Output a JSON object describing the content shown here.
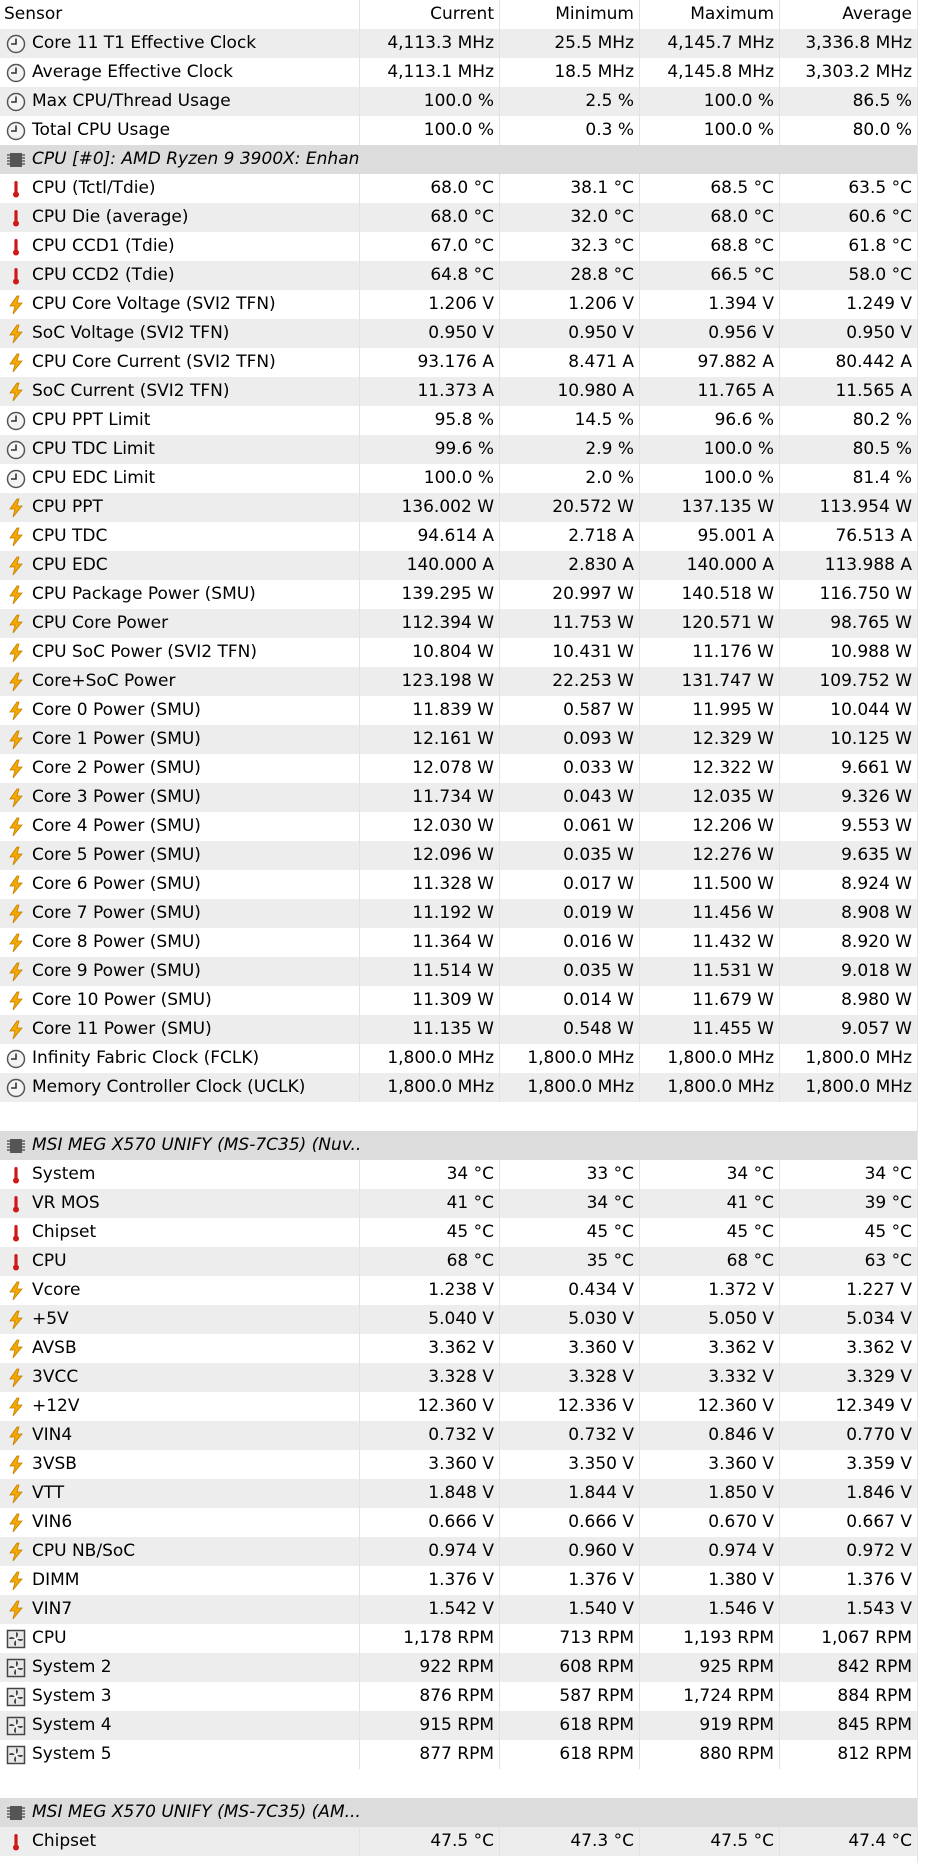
{
  "columns": [
    "Sensor",
    "Current",
    "Minimum",
    "Maximum",
    "Average"
  ],
  "rows": [
    {
      "kind": "sensor",
      "icon": "clock-icon",
      "name": "Core 11 T1 Effective Clock",
      "cur": "4,113.3 MHz",
      "min": "25.5 MHz",
      "max": "4,145.7 MHz",
      "avg": "3,336.8 MHz"
    },
    {
      "kind": "sensor",
      "icon": "clock-icon",
      "name": "Average Effective Clock",
      "cur": "4,113.1 MHz",
      "min": "18.5 MHz",
      "max": "4,145.8 MHz",
      "avg": "3,303.2 MHz"
    },
    {
      "kind": "sensor",
      "icon": "clock-icon",
      "name": "Max CPU/Thread Usage",
      "cur": "100.0 %",
      "min": "2.5 %",
      "max": "100.0 %",
      "avg": "86.5 %"
    },
    {
      "kind": "sensor",
      "icon": "clock-icon",
      "name": "Total CPU Usage",
      "cur": "100.0 %",
      "min": "0.3 %",
      "max": "100.0 %",
      "avg": "80.0 %"
    },
    {
      "kind": "group",
      "icon": "chip-icon",
      "name": "CPU [#0]: AMD Ryzen 9 3900X: Enhan..."
    },
    {
      "kind": "sensor",
      "icon": "thermometer-icon",
      "name": "CPU (Tctl/Tdie)",
      "cur": "68.0 °C",
      "min": "38.1 °C",
      "max": "68.5 °C",
      "avg": "63.5 °C"
    },
    {
      "kind": "sensor",
      "icon": "thermometer-icon",
      "name": "CPU Die (average)",
      "cur": "68.0 °C",
      "min": "32.0 °C",
      "max": "68.0 °C",
      "avg": "60.6 °C"
    },
    {
      "kind": "sensor",
      "icon": "thermometer-icon",
      "name": "CPU CCD1 (Tdie)",
      "cur": "67.0 °C",
      "min": "32.3 °C",
      "max": "68.8 °C",
      "avg": "61.8 °C"
    },
    {
      "kind": "sensor",
      "icon": "thermometer-icon",
      "name": "CPU CCD2 (Tdie)",
      "cur": "64.8 °C",
      "min": "28.8 °C",
      "max": "66.5 °C",
      "avg": "58.0 °C"
    },
    {
      "kind": "sensor",
      "icon": "lightning-icon",
      "name": "CPU Core Voltage (SVI2 TFN)",
      "cur": "1.206 V",
      "min": "1.206 V",
      "max": "1.394 V",
      "avg": "1.249 V"
    },
    {
      "kind": "sensor",
      "icon": "lightning-icon",
      "name": "SoC Voltage (SVI2 TFN)",
      "cur": "0.950 V",
      "min": "0.950 V",
      "max": "0.956 V",
      "avg": "0.950 V"
    },
    {
      "kind": "sensor",
      "icon": "lightning-icon",
      "name": "CPU Core Current (SVI2 TFN)",
      "cur": "93.176 A",
      "min": "8.471 A",
      "max": "97.882 A",
      "avg": "80.442 A"
    },
    {
      "kind": "sensor",
      "icon": "lightning-icon",
      "name": "SoC Current (SVI2 TFN)",
      "cur": "11.373 A",
      "min": "10.980 A",
      "max": "11.765 A",
      "avg": "11.565 A"
    },
    {
      "kind": "sensor",
      "icon": "clock-icon",
      "name": "CPU PPT Limit",
      "cur": "95.8 %",
      "min": "14.5 %",
      "max": "96.6 %",
      "avg": "80.2 %"
    },
    {
      "kind": "sensor",
      "icon": "clock-icon",
      "name": "CPU TDC Limit",
      "cur": "99.6 %",
      "min": "2.9 %",
      "max": "100.0 %",
      "avg": "80.5 %"
    },
    {
      "kind": "sensor",
      "icon": "clock-icon",
      "name": "CPU EDC Limit",
      "cur": "100.0 %",
      "min": "2.0 %",
      "max": "100.0 %",
      "avg": "81.4 %"
    },
    {
      "kind": "sensor",
      "icon": "lightning-icon",
      "name": "CPU PPT",
      "cur": "136.002 W",
      "min": "20.572 W",
      "max": "137.135 W",
      "avg": "113.954 W"
    },
    {
      "kind": "sensor",
      "icon": "lightning-icon",
      "name": "CPU TDC",
      "cur": "94.614 A",
      "min": "2.718 A",
      "max": "95.001 A",
      "avg": "76.513 A"
    },
    {
      "kind": "sensor",
      "icon": "lightning-icon",
      "name": "CPU EDC",
      "cur": "140.000 A",
      "min": "2.830 A",
      "max": "140.000 A",
      "avg": "113.988 A"
    },
    {
      "kind": "sensor",
      "icon": "lightning-icon",
      "name": "CPU Package Power (SMU)",
      "cur": "139.295 W",
      "min": "20.997 W",
      "max": "140.518 W",
      "avg": "116.750 W"
    },
    {
      "kind": "sensor",
      "icon": "lightning-icon",
      "name": "CPU Core Power",
      "cur": "112.394 W",
      "min": "11.753 W",
      "max": "120.571 W",
      "avg": "98.765 W"
    },
    {
      "kind": "sensor",
      "icon": "lightning-icon",
      "name": "CPU SoC Power (SVI2 TFN)",
      "cur": "10.804 W",
      "min": "10.431 W",
      "max": "11.176 W",
      "avg": "10.988 W"
    },
    {
      "kind": "sensor",
      "icon": "lightning-icon",
      "name": "Core+SoC Power",
      "cur": "123.198 W",
      "min": "22.253 W",
      "max": "131.747 W",
      "avg": "109.752 W"
    },
    {
      "kind": "sensor",
      "icon": "lightning-icon",
      "name": "Core 0 Power (SMU)",
      "cur": "11.839 W",
      "min": "0.587 W",
      "max": "11.995 W",
      "avg": "10.044 W"
    },
    {
      "kind": "sensor",
      "icon": "lightning-icon",
      "name": "Core 1 Power (SMU)",
      "cur": "12.161 W",
      "min": "0.093 W",
      "max": "12.329 W",
      "avg": "10.125 W"
    },
    {
      "kind": "sensor",
      "icon": "lightning-icon",
      "name": "Core 2 Power (SMU)",
      "cur": "12.078 W",
      "min": "0.033 W",
      "max": "12.322 W",
      "avg": "9.661 W"
    },
    {
      "kind": "sensor",
      "icon": "lightning-icon",
      "name": "Core 3 Power (SMU)",
      "cur": "11.734 W",
      "min": "0.043 W",
      "max": "12.035 W",
      "avg": "9.326 W"
    },
    {
      "kind": "sensor",
      "icon": "lightning-icon",
      "name": "Core 4 Power (SMU)",
      "cur": "12.030 W",
      "min": "0.061 W",
      "max": "12.206 W",
      "avg": "9.553 W"
    },
    {
      "kind": "sensor",
      "icon": "lightning-icon",
      "name": "Core 5 Power (SMU)",
      "cur": "12.096 W",
      "min": "0.035 W",
      "max": "12.276 W",
      "avg": "9.635 W"
    },
    {
      "kind": "sensor",
      "icon": "lightning-icon",
      "name": "Core 6 Power (SMU)",
      "cur": "11.328 W",
      "min": "0.017 W",
      "max": "11.500 W",
      "avg": "8.924 W"
    },
    {
      "kind": "sensor",
      "icon": "lightning-icon",
      "name": "Core 7 Power (SMU)",
      "cur": "11.192 W",
      "min": "0.019 W",
      "max": "11.456 W",
      "avg": "8.908 W"
    },
    {
      "kind": "sensor",
      "icon": "lightning-icon",
      "name": "Core 8 Power (SMU)",
      "cur": "11.364 W",
      "min": "0.016 W",
      "max": "11.432 W",
      "avg": "8.920 W"
    },
    {
      "kind": "sensor",
      "icon": "lightning-icon",
      "name": "Core 9 Power (SMU)",
      "cur": "11.514 W",
      "min": "0.035 W",
      "max": "11.531 W",
      "avg": "9.018 W"
    },
    {
      "kind": "sensor",
      "icon": "lightning-icon",
      "name": "Core 10 Power (SMU)",
      "cur": "11.309 W",
      "min": "0.014 W",
      "max": "11.679 W",
      "avg": "8.980 W"
    },
    {
      "kind": "sensor",
      "icon": "lightning-icon",
      "name": "Core 11 Power (SMU)",
      "cur": "11.135 W",
      "min": "0.548 W",
      "max": "11.455 W",
      "avg": "9.057 W"
    },
    {
      "kind": "sensor",
      "icon": "clock-icon",
      "name": "Infinity Fabric Clock (FCLK)",
      "cur": "1,800.0 MHz",
      "min": "1,800.0 MHz",
      "max": "1,800.0 MHz",
      "avg": "1,800.0 MHz"
    },
    {
      "kind": "sensor",
      "icon": "clock-icon",
      "name": "Memory Controller Clock (UCLK)",
      "cur": "1,800.0 MHz",
      "min": "1,800.0 MHz",
      "max": "1,800.0 MHz",
      "avg": "1,800.0 MHz"
    },
    {
      "kind": "blank"
    },
    {
      "kind": "group",
      "icon": "chip-icon",
      "name": "MSI MEG X570 UNIFY (MS-7C35) (Nuv..."
    },
    {
      "kind": "sensor",
      "icon": "thermometer-icon",
      "name": "System",
      "cur": "34 °C",
      "min": "33 °C",
      "max": "34 °C",
      "avg": "34 °C"
    },
    {
      "kind": "sensor",
      "icon": "thermometer-icon",
      "name": "VR MOS",
      "cur": "41 °C",
      "min": "34 °C",
      "max": "41 °C",
      "avg": "39 °C"
    },
    {
      "kind": "sensor",
      "icon": "thermometer-icon",
      "name": "Chipset",
      "cur": "45 °C",
      "min": "45 °C",
      "max": "45 °C",
      "avg": "45 °C"
    },
    {
      "kind": "sensor",
      "icon": "thermometer-icon",
      "name": "CPU",
      "cur": "68 °C",
      "min": "35 °C",
      "max": "68 °C",
      "avg": "63 °C"
    },
    {
      "kind": "sensor",
      "icon": "lightning-icon",
      "name": "Vcore",
      "cur": "1.238 V",
      "min": "0.434 V",
      "max": "1.372 V",
      "avg": "1.227 V"
    },
    {
      "kind": "sensor",
      "icon": "lightning-icon",
      "name": "+5V",
      "cur": "5.040 V",
      "min": "5.030 V",
      "max": "5.050 V",
      "avg": "5.034 V"
    },
    {
      "kind": "sensor",
      "icon": "lightning-icon",
      "name": "AVSB",
      "cur": "3.362 V",
      "min": "3.360 V",
      "max": "3.362 V",
      "avg": "3.362 V"
    },
    {
      "kind": "sensor",
      "icon": "lightning-icon",
      "name": "3VCC",
      "cur": "3.328 V",
      "min": "3.328 V",
      "max": "3.332 V",
      "avg": "3.329 V"
    },
    {
      "kind": "sensor",
      "icon": "lightning-icon",
      "name": "+12V",
      "cur": "12.360 V",
      "min": "12.336 V",
      "max": "12.360 V",
      "avg": "12.349 V"
    },
    {
      "kind": "sensor",
      "icon": "lightning-icon",
      "name": "VIN4",
      "cur": "0.732 V",
      "min": "0.732 V",
      "max": "0.846 V",
      "avg": "0.770 V"
    },
    {
      "kind": "sensor",
      "icon": "lightning-icon",
      "name": "3VSB",
      "cur": "3.360 V",
      "min": "3.350 V",
      "max": "3.360 V",
      "avg": "3.359 V"
    },
    {
      "kind": "sensor",
      "icon": "lightning-icon",
      "name": "VTT",
      "cur": "1.848 V",
      "min": "1.844 V",
      "max": "1.850 V",
      "avg": "1.846 V"
    },
    {
      "kind": "sensor",
      "icon": "lightning-icon",
      "name": "VIN6",
      "cur": "0.666 V",
      "min": "0.666 V",
      "max": "0.670 V",
      "avg": "0.667 V"
    },
    {
      "kind": "sensor",
      "icon": "lightning-icon",
      "name": "CPU NB/SoC",
      "cur": "0.974 V",
      "min": "0.960 V",
      "max": "0.974 V",
      "avg": "0.972 V"
    },
    {
      "kind": "sensor",
      "icon": "lightning-icon",
      "name": "DIMM",
      "cur": "1.376 V",
      "min": "1.376 V",
      "max": "1.380 V",
      "avg": "1.376 V"
    },
    {
      "kind": "sensor",
      "icon": "lightning-icon",
      "name": "VIN7",
      "cur": "1.542 V",
      "min": "1.540 V",
      "max": "1.546 V",
      "avg": "1.543 V"
    },
    {
      "kind": "sensor",
      "icon": "fan-icon",
      "name": "CPU",
      "cur": "1,178 RPM",
      "min": "713 RPM",
      "max": "1,193 RPM",
      "avg": "1,067 RPM"
    },
    {
      "kind": "sensor",
      "icon": "fan-icon",
      "name": "System 2",
      "cur": "922 RPM",
      "min": "608 RPM",
      "max": "925 RPM",
      "avg": "842 RPM"
    },
    {
      "kind": "sensor",
      "icon": "fan-icon",
      "name": "System 3",
      "cur": "876 RPM",
      "min": "587 RPM",
      "max": "1,724 RPM",
      "avg": "884 RPM"
    },
    {
      "kind": "sensor",
      "icon": "fan-icon",
      "name": "System 4",
      "cur": "915 RPM",
      "min": "618 RPM",
      "max": "919 RPM",
      "avg": "845 RPM"
    },
    {
      "kind": "sensor",
      "icon": "fan-icon",
      "name": "System 5",
      "cur": "877 RPM",
      "min": "618 RPM",
      "max": "880 RPM",
      "avg": "812 RPM"
    },
    {
      "kind": "blank"
    },
    {
      "kind": "group",
      "icon": "chip-icon",
      "name": "MSI MEG X570 UNIFY (MS-7C35) (AM..."
    },
    {
      "kind": "sensor",
      "icon": "thermometer-icon",
      "name": "Chipset",
      "cur": "47.5 °C",
      "min": "47.3 °C",
      "max": "47.5 °C",
      "avg": "47.4 °C"
    }
  ],
  "colors": {
    "stripe": "#ededed",
    "group": "#dcdcdc",
    "thermo": "#d01818",
    "bolt": "#f5a800"
  }
}
